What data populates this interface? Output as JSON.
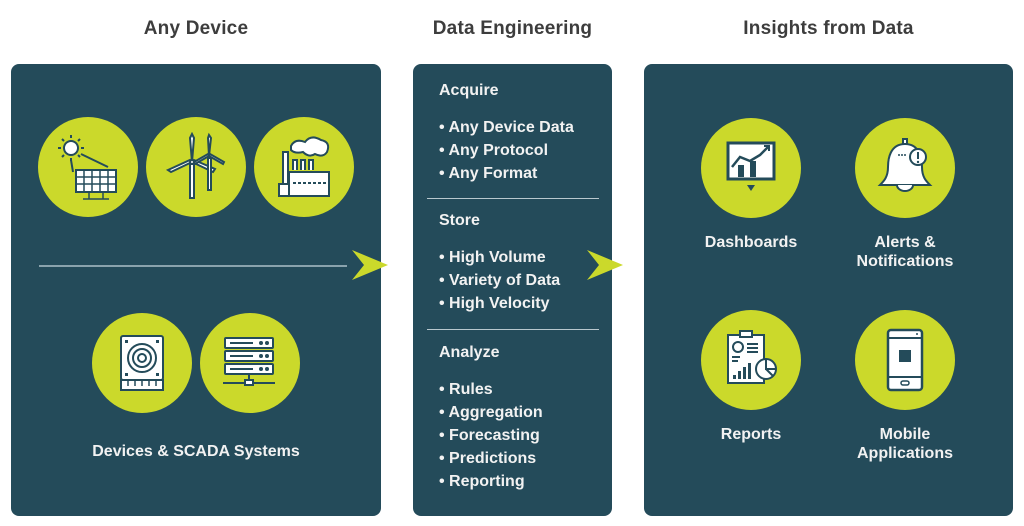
{
  "columns": {
    "any_device": {
      "title": "Any Device",
      "energy_icons": [
        "solar-panel-icon",
        "wind-turbine-icon",
        "factory-icon"
      ],
      "device_icons": [
        "hard-drive-icon",
        "server-rack-icon"
      ],
      "devices_label": "Devices & SCADA Systems"
    },
    "data_engineering": {
      "title": "Data Engineering",
      "sections": [
        {
          "title": "Acquire",
          "items": [
            "Any Device Data",
            "Any Protocol",
            "Any Format"
          ]
        },
        {
          "title": "Store",
          "items": [
            "High Volume",
            "Variety of Data",
            "High Velocity"
          ]
        },
        {
          "title": "Analyze",
          "items": [
            "Rules",
            "Aggregation",
            "Forecasting",
            "Predictions",
            "Reporting"
          ]
        }
      ]
    },
    "insights": {
      "title": "Insights from Data",
      "tiles": [
        {
          "icon": "dashboard-chart-icon",
          "label": "Dashboards"
        },
        {
          "icon": "bell-alert-icon",
          "label": "Alerts & Notifications"
        },
        {
          "icon": "report-clipboard-icon",
          "label": "Reports"
        },
        {
          "icon": "mobile-phone-icon",
          "label": "Mobile Applications"
        }
      ]
    }
  },
  "colors": {
    "panel": "#244b5a",
    "accent": "#cbd92b",
    "title_text": "#3d3d3d",
    "panel_text": "#f2f2f2"
  }
}
